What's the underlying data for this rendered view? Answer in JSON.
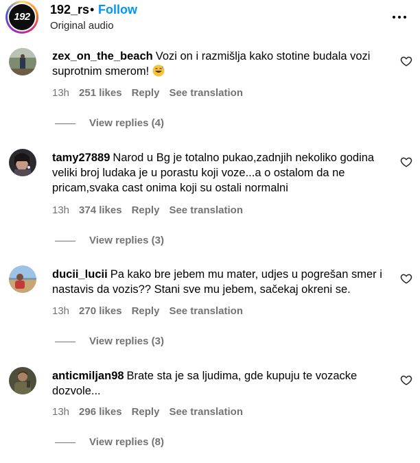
{
  "header": {
    "logo_text": "192",
    "account_name": "192_rs",
    "separator": "•",
    "follow_label": "Follow",
    "audio_label": "Original audio"
  },
  "comments": [
    {
      "username": "zex_on_the_beach",
      "text": "Vozi on i razmišlja kako stotine budala vozi suprotnim smerom!",
      "emoji": "grinning-sweat-emoji",
      "time": "13h",
      "likes": "251 likes",
      "reply": "Reply",
      "translation": "See translation",
      "view_replies": "View replies (4)"
    },
    {
      "username": "tamy27889",
      "text": "Narod u Bg je totalno pukao,zadnjih nekoliko godina veliki broj ludaka je u porastu koji voze...a o ostalom da ne pricam,svaka cast onima koji su ostali normalni",
      "time": "13h",
      "likes": "374 likes",
      "reply": "Reply",
      "translation": "See translation",
      "view_replies": "View replies (3)"
    },
    {
      "username": "ducii_lucii",
      "text": "Pa kako bre jebem mu mater, udjes u pogrešan smer i nastavis da vozis?? Stani sve mu jebem, sačekaj okreni se.",
      "time": "13h",
      "likes": "270 likes",
      "reply": "Reply",
      "translation": "See translation",
      "view_replies": "View replies (3)"
    },
    {
      "username": "anticmiljan98",
      "text": "Brate sta je sa ljudima, gde kupuju te vozacke dozvole...",
      "time": "13h",
      "likes": "296 likes",
      "reply": "Reply",
      "translation": "See translation",
      "view_replies": "View replies (8)"
    }
  ],
  "icons": {
    "more": "more-options-icon",
    "like": "heart-icon"
  },
  "colors": {
    "follow": "#0095f6",
    "meta": "#737373"
  }
}
